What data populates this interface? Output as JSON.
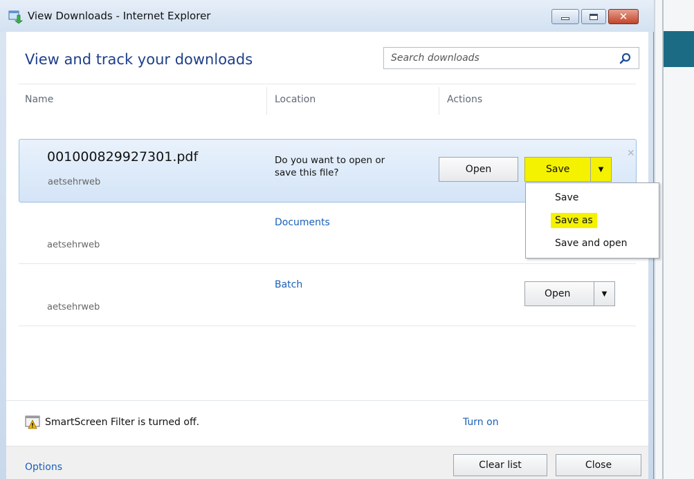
{
  "window": {
    "title": "View Downloads - Internet Explorer",
    "controls": {
      "minimize": "minimize",
      "maximize": "maximize",
      "close": "close"
    }
  },
  "header": {
    "title": "View and track your downloads",
    "search_placeholder": "Search downloads"
  },
  "columns": [
    "Name",
    "Location",
    "Actions"
  ],
  "downloads": [
    {
      "name": "001000829927301.pdf",
      "source": "aetsehrweb",
      "prompt_line1": "Do you want to open or",
      "prompt_line2": "save this file?",
      "open_label": "Open",
      "save_label": "Save"
    },
    {
      "name": "",
      "source": "aetsehrweb",
      "location": "Documents"
    },
    {
      "name": "",
      "source": "aetsehrweb",
      "location": "Batch",
      "open_label": "Open"
    }
  ],
  "save_menu": [
    "Save",
    "Save as",
    "Save and open"
  ],
  "footer": {
    "smartscreen_text": "SmartScreen Filter is turned off.",
    "turn_on": "Turn on",
    "options": "Options",
    "clear_list": "Clear list",
    "close": "Close"
  },
  "colors": {
    "highlight": "#f4f200",
    "link": "#1a5fb8",
    "title_blue": "#1e3f8a"
  }
}
